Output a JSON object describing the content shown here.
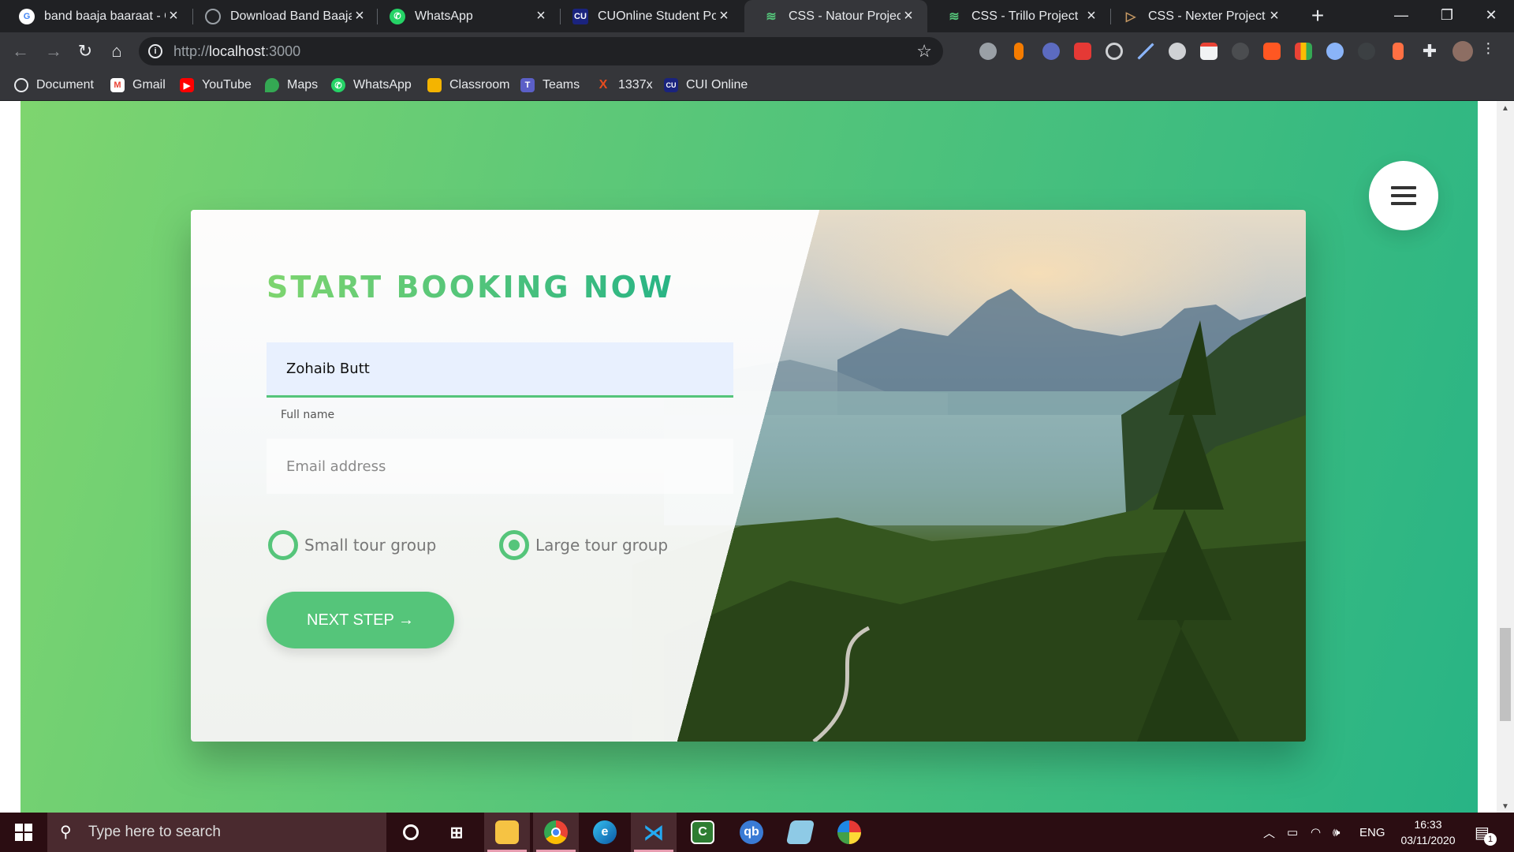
{
  "browser": {
    "tabs": [
      {
        "title": "band baaja baaraat - G",
        "icon": "google-icon",
        "color": "#ffffff"
      },
      {
        "title": "Download Band Baaja B",
        "icon": "globe-icon",
        "color": "#9aa0a6"
      },
      {
        "title": "WhatsApp",
        "icon": "whatsapp-icon",
        "color": "#25d366"
      },
      {
        "title": "CUOnline Student Port",
        "icon": "cui-icon",
        "color": "#1a237e"
      },
      {
        "title": "CSS - Natour Project",
        "icon": "natours-icon",
        "color": "#55c57a"
      },
      {
        "title": "CSS - Trillo Project",
        "icon": "trillo-icon",
        "color": "#55c57a"
      },
      {
        "title": "CSS - Nexter Project",
        "icon": "nexter-icon",
        "color": "#c69963"
      }
    ],
    "url": {
      "protocol": "http://",
      "host": "localhost",
      "port": ":3000"
    },
    "bookmarks": [
      {
        "label": "Document",
        "icon": "globe-icon",
        "color": "#9aa0a6"
      },
      {
        "label": "Gmail",
        "icon": "gmail-icon",
        "color": "#ea4335"
      },
      {
        "label": "YouTube",
        "icon": "youtube-icon",
        "color": "#ff0000"
      },
      {
        "label": "Maps",
        "icon": "maps-icon",
        "color": "#34a853"
      },
      {
        "label": "WhatsApp",
        "icon": "whatsapp-icon",
        "color": "#25d366"
      },
      {
        "label": "Classroom",
        "icon": "classroom-icon",
        "color": "#f4b400"
      },
      {
        "label": "Teams",
        "icon": "teams-icon",
        "color": "#5b5fc7"
      },
      {
        "label": "1337x",
        "icon": "1337x-icon",
        "color": "#e84c1e"
      },
      {
        "label": "CUI Online",
        "icon": "cui-icon",
        "color": "#1a237e"
      }
    ]
  },
  "page": {
    "booking": {
      "title": "Start booking now",
      "name_value": "Zohaib Butt",
      "name_label": "Full name",
      "email_placeholder": "Email address",
      "radio_small": "Small tour group",
      "radio_large": "Large tour group",
      "selected_option": "Large tour group",
      "button_label": "Next step →"
    }
  },
  "taskbar": {
    "search_placeholder": "Type here to search",
    "language": "ENG",
    "time": "16:33",
    "date": "03/11/2020",
    "notification_count": "1",
    "apps": [
      "cortana-icon",
      "task-view-icon",
      "file-explorer-icon",
      "chrome-icon",
      "edge-icon",
      "vscode-icon",
      "ccleaner-icon",
      "qbittorrent-icon",
      "notepad-icon",
      "paint-icon"
    ]
  },
  "colors": {
    "green_light": "#7ed56f",
    "green_primary": "#55c57a",
    "green_dark": "#28b485"
  }
}
